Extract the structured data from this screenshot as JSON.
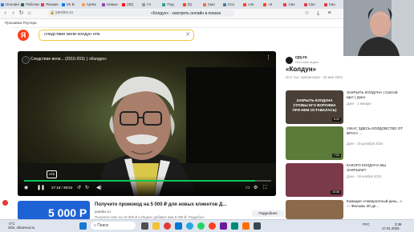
{
  "browser": {
    "tabs": [
      {
        "label": "Основная",
        "color": "#3b7cf0"
      },
      {
        "label": "Рабочая",
        "color": "#2d6a4f"
      },
      {
        "label": "Рекоме",
        "color": "#e63946"
      },
      {
        "label": "VK В",
        "color": "#0077ff"
      },
      {
        "label": "Артёк",
        "color": "#f4a261"
      },
      {
        "label": "Новые",
        "color": "#8e44ad"
      },
      {
        "label": "(30)",
        "color": "#ff0000"
      },
      {
        "label": "Гл",
        "color": "#999999"
      },
      {
        "label": "Под",
        "color": "#2a9d8f"
      },
      {
        "label": "(5)",
        "color": "#fc3f1d"
      },
      {
        "label": "Смо",
        "color": "#e76f51"
      },
      {
        "label": "Спо",
        "color": "#457b9d"
      },
      {
        "label": "сле",
        "color": "#fc3f1d"
      },
      {
        "label": "«К",
        "color": "#fc3f1d"
      },
      {
        "label": "Сво",
        "color": "#e63946"
      },
      {
        "label": "Сво",
        "color": "#e63946"
      },
      {
        "label": "Сво",
        "color": "#e63946"
      }
    ],
    "url": "yandex.ru",
    "page_title": "«Колдун» - смотреть онлайн в поиске Яндекса по Видео",
    "bookmarks_label": "Прошивка Роутера"
  },
  "search": {
    "logo": "Я",
    "query": "следствие вели колдун нтв",
    "clear_icon": "close-icon"
  },
  "player": {
    "title": "Следствие вели... (2010-2011 ) «Колдун»",
    "time": "37:18 / 39:53",
    "progress": 0.935,
    "ntv_logo": "НТВ",
    "colors": {
      "progress": "#00c853"
    }
  },
  "ad": {
    "thumb_text": "5 000 Р",
    "title": "Получите промокод на 5 000 ₽ для новых клиентов Д...",
    "url": "yandex.ru",
    "text": "Получите свет на 10 000 ₽ и Яндекс добавит вам 5 000 ₽. Подробно",
    "button": "Подробнее"
  },
  "side": {
    "source_name": "cpy.ru",
    "source_sub": "Источник видео",
    "title": "«Колдун»",
    "meta": "20,2 тыс. просмотров · 22 мая 2024",
    "cards": [
      {
        "title": "ЗАКРЫТЬ КОЛДУНА | Святой Щит | Дзен",
        "meta": "Дзен · 1 января",
        "overlay": "ЗАКРЫТЬ КОЛДУНА (ЧТОБЫ ЕГО ВОРОЖБА ПРИ НЕМ ОСТАВАЛАСЬ)",
        "duration": "6:20"
      },
      {
        "title": "УЖАС ЗДЕСЬ КОЛДОВСТВО ОТ ВРАГА ...",
        "meta": "Дзен · 25 декабря 2024",
        "overlay": "",
        "duration": "7:31"
      },
      {
        "title": "КАКОГО КОЛДУНА ВЫ ЗАКРЫЛИ?",
        "meta": "Дзен · 19 ноября 2024",
        "overlay": "",
        "duration": "15:08"
      },
      {
        "title": "Комедия «Невероятный день...» — Фильмы 30 де...",
        "meta": "",
        "overlay": "",
        "duration": ""
      }
    ]
  },
  "taskbar": {
    "weather_temp": "-2°C",
    "weather_text": "Обл. облачность",
    "search_placeholder": "Поиск",
    "lang": "РУС",
    "time": "3:38",
    "date": "17.01.2025"
  }
}
